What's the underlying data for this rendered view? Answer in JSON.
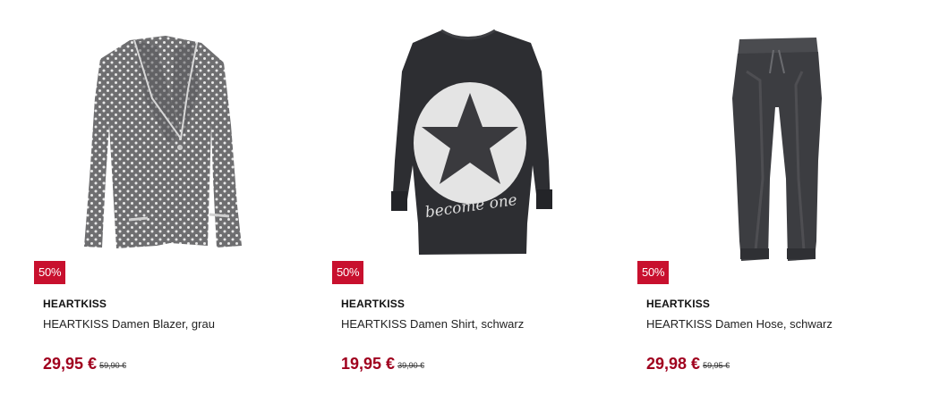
{
  "products": [
    {
      "discount": "50%",
      "brand": "HEARTKISS",
      "name": "HEARTKISS Damen Blazer, grau",
      "price": "29,95 €",
      "old_price": "59,90 €",
      "image": "grey-polka-dot-blazer"
    },
    {
      "discount": "50%",
      "brand": "HEARTKISS",
      "name": "HEARTKISS Damen Shirt, schwarz",
      "price": "19,95 €",
      "old_price": "39,90 €",
      "image": "black-star-shirt",
      "image_text": "become one"
    },
    {
      "discount": "50%",
      "brand": "HEARTKISS",
      "name": "HEARTKISS Damen Hose, schwarz",
      "price": "29,98 €",
      "old_price": "59,95 €",
      "image": "black-jogger-pants"
    }
  ],
  "colors": {
    "badge": "#c8102e",
    "price": "#a0001e"
  }
}
